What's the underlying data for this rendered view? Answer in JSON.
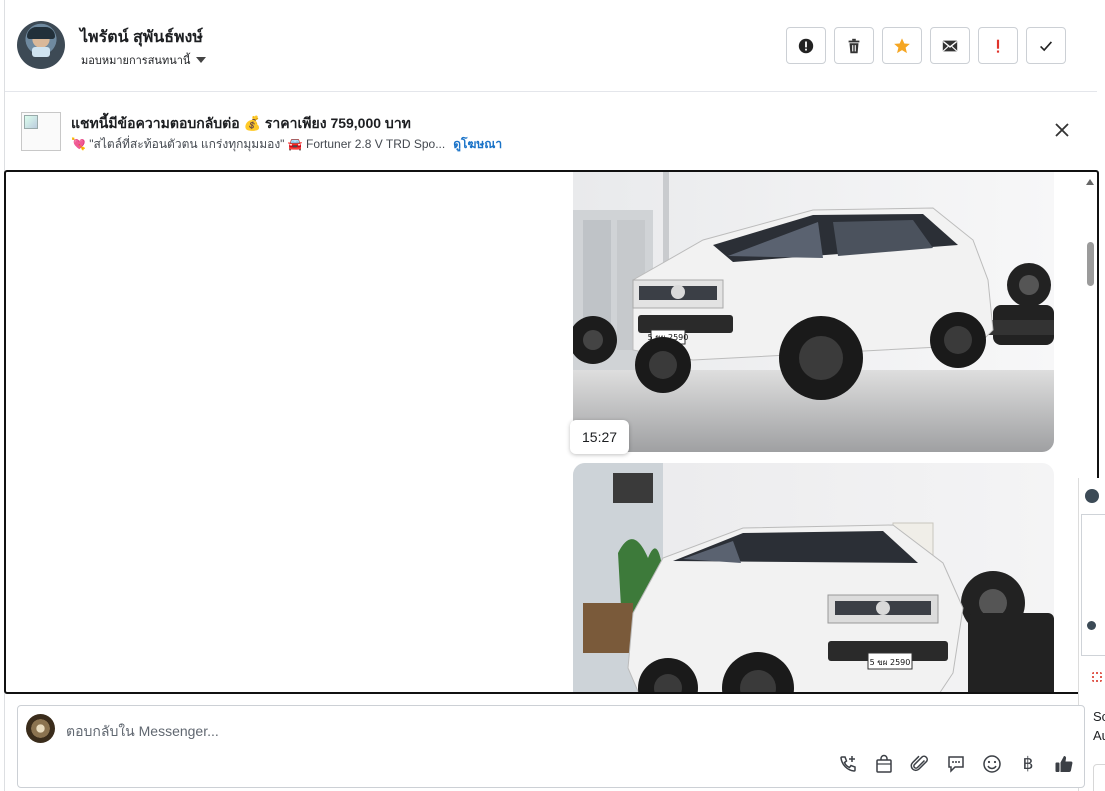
{
  "contact": {
    "name": "ไพรัตน์ สุพันธ์พงษ์",
    "assign_label": "มอบหมายการสนทนานี้"
  },
  "actions": [
    {
      "name": "report-spam-button",
      "icon": "alert-circle-icon"
    },
    {
      "name": "delete-button",
      "icon": "trash-icon"
    },
    {
      "name": "star-button",
      "icon": "star-icon",
      "color": "#f5a623"
    },
    {
      "name": "mark-unread-button",
      "icon": "envelope-icon"
    },
    {
      "name": "important-button",
      "icon": "exclamation-icon",
      "color": "#e0342c"
    },
    {
      "name": "mark-done-button",
      "icon": "check-icon"
    }
  ],
  "ad": {
    "title": "แชทนี้มีข้อความตอบกลับต่อ 💰 ราคาเพียง 759,000 บาท",
    "subtitle": "💘 \"สไตล์ที่สะท้อนตัวตน แกร่งทุกมุมมอง\" 🚘 Fortuner 2.8 V TRD Spo...",
    "link_label": "ดูโฆษณา"
  },
  "thread": {
    "timestamp": "15:27",
    "plate": "5 ขผ 2590"
  },
  "composer": {
    "placeholder": "ตอบกลับใน Messenger...",
    "baht_symbol": "฿"
  },
  "side_panel": {
    "line1": "Sc",
    "line2": "Au"
  },
  "colors": {
    "accent_link": "#1a73c8",
    "border": "#ccd0d5",
    "thumb": "#3b3f45"
  }
}
